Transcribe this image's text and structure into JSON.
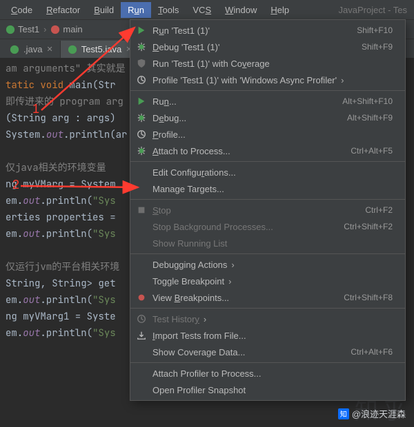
{
  "menubar": {
    "items": [
      {
        "label": "Code",
        "ul": "C"
      },
      {
        "label": "Refactor",
        "ul": "R"
      },
      {
        "label": "Build",
        "ul": "B"
      },
      {
        "label": "Run",
        "ul": "u",
        "selected": true
      },
      {
        "label": "Tools",
        "ul": "T"
      },
      {
        "label": "VCS",
        "ul": "S"
      },
      {
        "label": "Window",
        "ul": "W"
      },
      {
        "label": "Help",
        "ul": "H"
      }
    ],
    "project_title": "JavaProject - Tes"
  },
  "crumbs": {
    "class": "Test1",
    "method": "main"
  },
  "tabs": [
    {
      "label": ".java",
      "active": false
    },
    {
      "label": "Test5.java",
      "active": true
    }
  ],
  "editor_lines": [
    {
      "t": "cmt",
      "text": "am arguments\" 其实就是"
    },
    {
      "t": "code_main",
      "kw1": "tatic ",
      "kw2": "void",
      "name": " main",
      "rest": "(Str"
    },
    {
      "t": "cmt",
      "text": "即传进来的 program arg"
    },
    {
      "t": "plain",
      "text": "(String arg : args)"
    },
    {
      "t": "out",
      "pre": "System.",
      "field": "out",
      "post": ".println(ar"
    },
    {
      "t": "blank",
      "text": ""
    },
    {
      "t": "cmt",
      "text": "仅java相关的环境变量"
    },
    {
      "t": "plain",
      "text": "ng myVMarg = System"
    },
    {
      "t": "outstr",
      "pre": "em.",
      "field": "out",
      "mid": ".println(",
      "str": "\"Sys"
    },
    {
      "t": "plain",
      "text": "erties properties ="
    },
    {
      "t": "outstr",
      "pre": "em.",
      "field": "out",
      "mid": ".println(",
      "str": "\"Sys"
    },
    {
      "t": "blank",
      "text": ""
    },
    {
      "t": "cmt",
      "text": "仅运行jvm的平台相关环境"
    },
    {
      "t": "plain",
      "text": "String, String> get"
    },
    {
      "t": "outstr",
      "pre": "em.",
      "field": "out",
      "mid": ".println(",
      "str": "\"Sys"
    },
    {
      "t": "plain",
      "text": "ng myVMarg1 = Syste"
    },
    {
      "t": "outstr",
      "pre": "em.",
      "field": "out",
      "mid": ".println(",
      "str": "\"Sys"
    }
  ],
  "annotations": {
    "num1": "1",
    "num2": "2"
  },
  "dropdown": [
    {
      "icon": "play",
      "label": "Run 'Test1 (1)'",
      "ul": "u",
      "sc": "Shift+F10"
    },
    {
      "icon": "bug",
      "label": "Debug 'Test1 (1)'",
      "ul": "D",
      "sc": "Shift+F9"
    },
    {
      "icon": "shield",
      "label": "Run 'Test1 (1)' with Coverage",
      "ul": "v"
    },
    {
      "icon": "profile",
      "label": "Profile 'Test1 (1)' with 'Windows Async Profiler'",
      "submenu": true
    },
    {
      "sep": true
    },
    {
      "icon": "play",
      "label": "Run...",
      "ul": "n",
      "sc": "Alt+Shift+F10"
    },
    {
      "icon": "bug",
      "label": "Debug...",
      "ul": "e",
      "sc": "Alt+Shift+F9"
    },
    {
      "icon": "profile",
      "label": "Profile...",
      "ul": "P"
    },
    {
      "icon": "attach",
      "label": "Attach to Process...",
      "ul": "A",
      "sc": "Ctrl+Alt+F5"
    },
    {
      "sep": true
    },
    {
      "icon": "blank",
      "label": "Edit Configurations...",
      "ul": "r"
    },
    {
      "icon": "blank",
      "label": "Manage Targets..."
    },
    {
      "sep": true
    },
    {
      "icon": "stop",
      "label": "Stop",
      "ul": "S",
      "sc": "Ctrl+F2",
      "disabled": true
    },
    {
      "icon": "blank",
      "label": "Stop Background Processes...",
      "sc": "Ctrl+Shift+F2",
      "disabled": true
    },
    {
      "icon": "blank",
      "label": "Show Running List",
      "disabled": true
    },
    {
      "sep": true
    },
    {
      "icon": "blank",
      "label": "Debugging Actions",
      "submenu": true
    },
    {
      "icon": "blank",
      "label": "Toggle Breakpoint",
      "submenu": true
    },
    {
      "icon": "redcircle",
      "label": "View Breakpoints...",
      "ul": "B",
      "sc": "Ctrl+Shift+F8"
    },
    {
      "sep": true
    },
    {
      "icon": "clock",
      "label": "Test History",
      "ul": "y",
      "submenu": true,
      "disabled": true
    },
    {
      "icon": "import",
      "label": "Import Tests from File...",
      "ul": "I"
    },
    {
      "icon": "blank",
      "label": "Show Coverage Data...",
      "ul": "g",
      "sc": "Ctrl+Alt+F6"
    },
    {
      "sep": true
    },
    {
      "icon": "blank",
      "label": "Attach Profiler to Process..."
    },
    {
      "icon": "blank",
      "label": "Open Profiler Snapshot"
    }
  ],
  "watermark": {
    "logo": "知",
    "handle": "@浪迹天涯森",
    "big": "知乎"
  }
}
